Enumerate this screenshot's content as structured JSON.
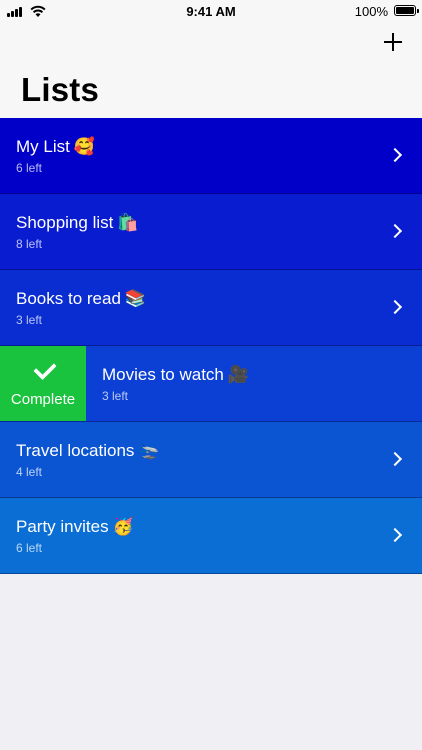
{
  "status_bar": {
    "time": "9:41 AM",
    "battery": "100%"
  },
  "header": {
    "title": "Lists",
    "add_icon": "plus-icon"
  },
  "swipe_action": {
    "label": "Complete",
    "icon": "checkmark-icon",
    "color": "#19c33e"
  },
  "lists": [
    {
      "title": "My List",
      "emoji": "🥰",
      "subtitle": "6 left",
      "color": "#0000c8"
    },
    {
      "title": "Shopping list",
      "emoji": "🛍️",
      "subtitle": "8 left",
      "color": "#0a1cd0"
    },
    {
      "title": "Books to read",
      "emoji": "📚",
      "subtitle": "3 left",
      "color": "#0a2dd2"
    },
    {
      "title": "Movies to watch",
      "emoji": "🎥",
      "subtitle": "3 left",
      "color": "#0c3fd4"
    },
    {
      "title": "Travel locations",
      "emoji": "🛬",
      "subtitle": "4 left",
      "color": "#0b55d2"
    },
    {
      "title": "Party invites",
      "emoji": "🥳",
      "subtitle": "6 left",
      "color": "#0a6ed4"
    }
  ]
}
